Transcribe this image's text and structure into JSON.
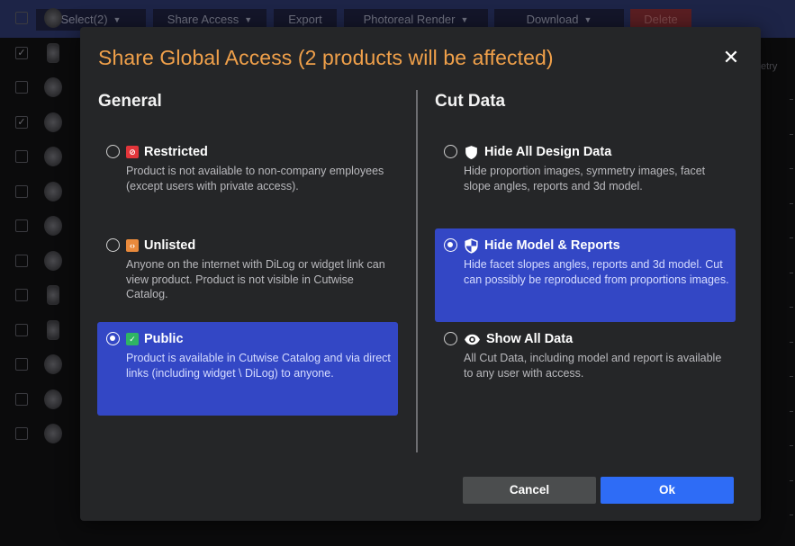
{
  "toolbar": {
    "select_label": "Select(2)",
    "share_access_label": "Share Access",
    "export_label": "Export",
    "photoreal_render_label": "Photoreal Render",
    "download_label": "Download",
    "delete_label": "Delete"
  },
  "table": {
    "column_label": "etry",
    "rows": [
      {
        "checked": false,
        "thumb": "round"
      },
      {
        "checked": true,
        "thumb": "emerald"
      },
      {
        "checked": false,
        "thumb": "round"
      },
      {
        "checked": true,
        "thumb": "round"
      },
      {
        "checked": false,
        "thumb": "round"
      },
      {
        "checked": false,
        "thumb": "round"
      },
      {
        "checked": false,
        "thumb": "round"
      },
      {
        "checked": false,
        "thumb": "round"
      },
      {
        "checked": false,
        "thumb": "emerald"
      },
      {
        "checked": false,
        "thumb": "emerald"
      },
      {
        "checked": false,
        "thumb": "round"
      },
      {
        "checked": false,
        "thumb": "round"
      },
      {
        "checked": false,
        "thumb": "round"
      }
    ]
  },
  "modal": {
    "title": "Share Global Access (2 products will be affected)",
    "close_glyph": "✕",
    "general": {
      "heading": "General",
      "options": [
        {
          "label": "Restricted",
          "icon": "restricted-icon",
          "icon_color": "#e2353a",
          "description": "Product is not available to non-company employees (except users with private access).",
          "selected": false
        },
        {
          "label": "Unlisted",
          "icon": "unlisted-icon",
          "icon_color": "#e98a3c",
          "description": "Anyone on the internet with DiLog or widget link can view product. Product is not visible in Cutwise Catalog.",
          "selected": false
        },
        {
          "label": "Public",
          "icon": "public-icon",
          "icon_color": "#2fb464",
          "description": "Product is available in Cutwise Catalog and via direct links (including widget \\ DiLog) to anyone.",
          "selected": true
        }
      ]
    },
    "cut_data": {
      "heading": "Cut Data",
      "options": [
        {
          "label": "Hide All Design Data",
          "icon": "shield-icon",
          "description": "Hide proportion images, symmetry images, facet slope angles, reports and 3d model.",
          "selected": false
        },
        {
          "label": "Hide Model & Reports",
          "icon": "half-shield-icon",
          "description": "Hide facet slopes angles, reports and 3d model. Cut can possibly be reproduced from proportions images.",
          "selected": true
        },
        {
          "label": "Show All Data",
          "icon": "eye-icon",
          "description": "All Cut Data, including model and report is available to any user with access.",
          "selected": false
        }
      ]
    },
    "cancel_label": "Cancel",
    "ok_label": "Ok"
  },
  "colors": {
    "title_accent": "#f0a04a",
    "selected_bg": "#3347c5",
    "ok_button": "#2e6cf6"
  }
}
